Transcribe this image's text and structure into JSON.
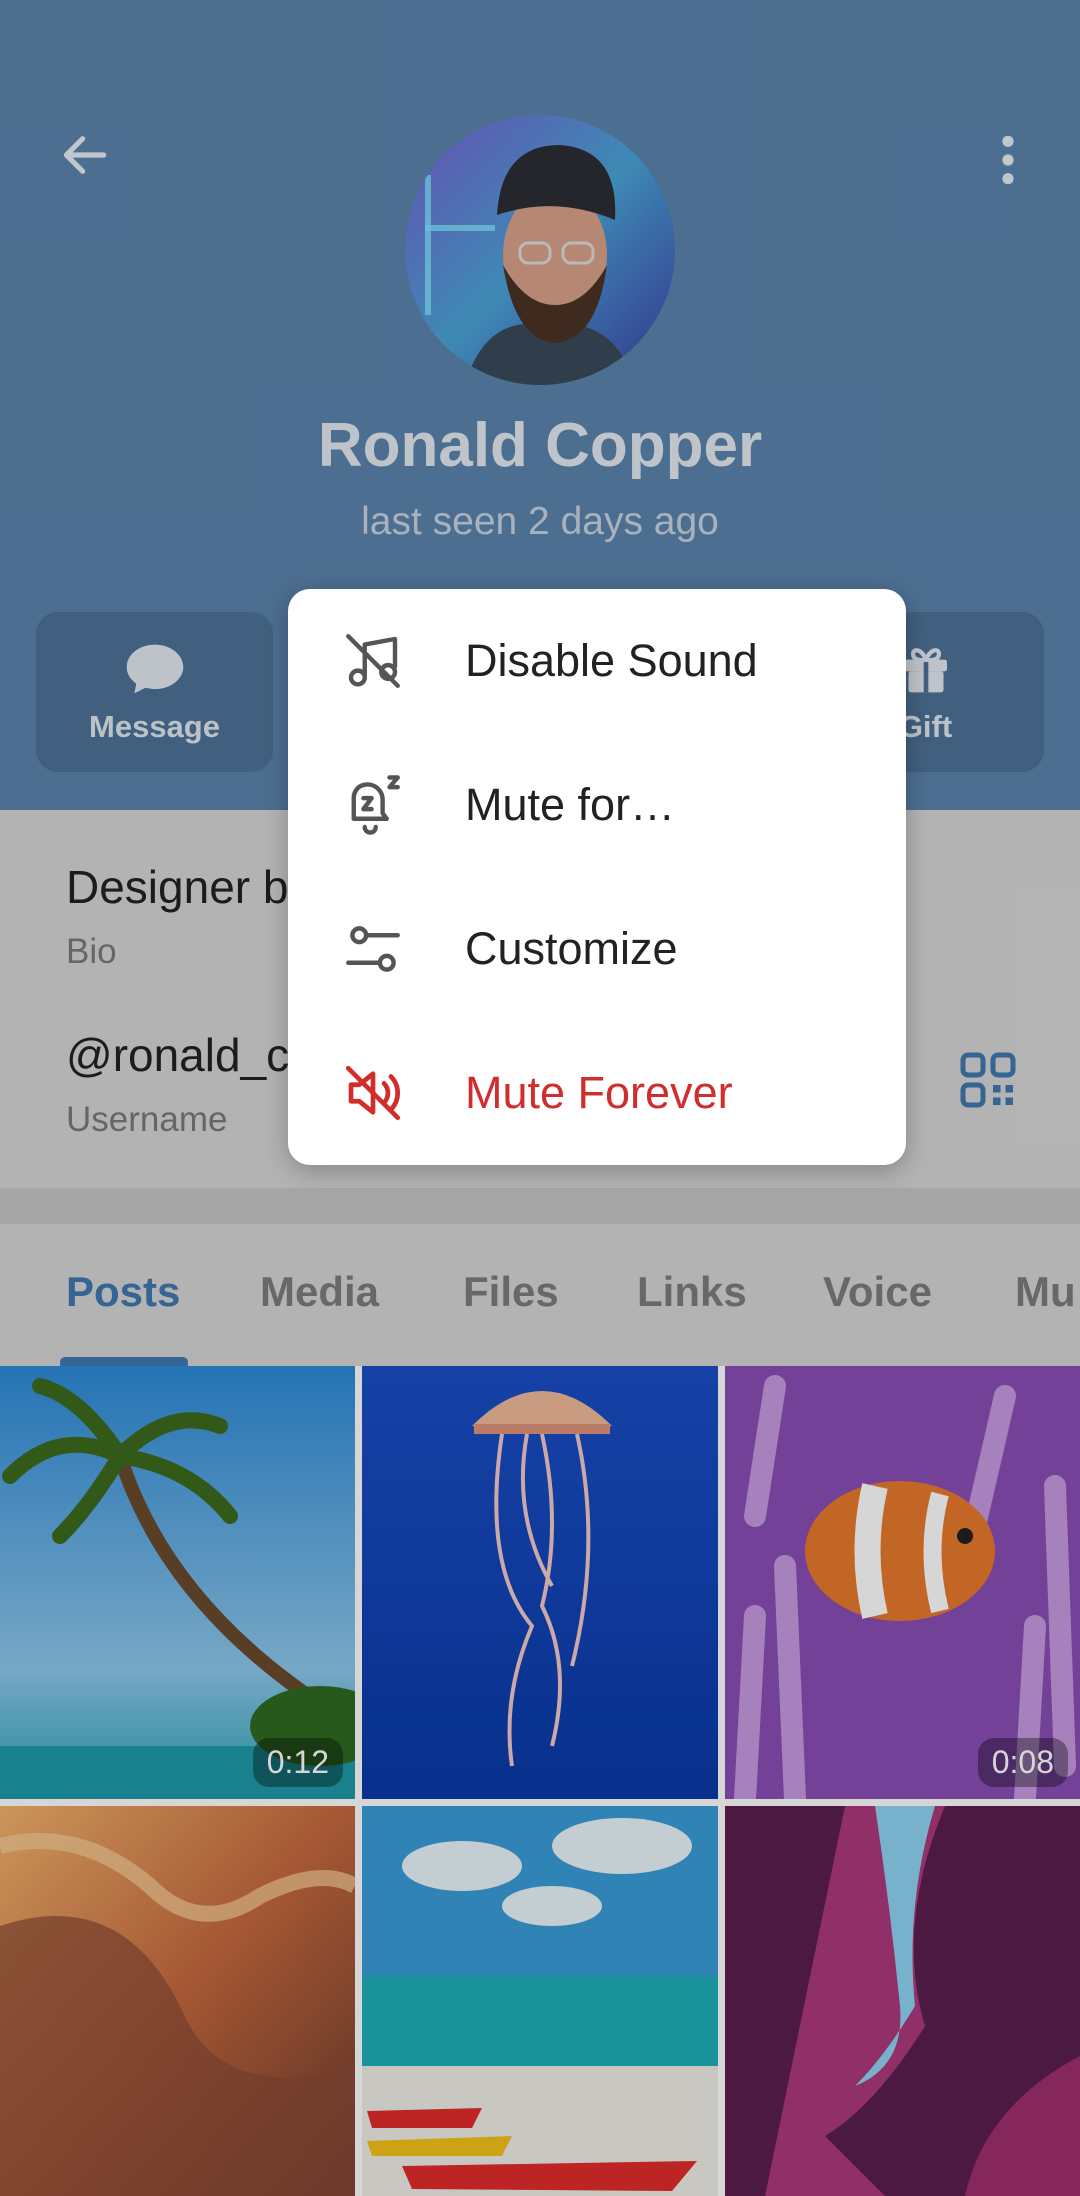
{
  "profile": {
    "name": "Ronald Copper",
    "status": "last seen 2 days ago"
  },
  "actions": {
    "message_label": "Message",
    "gift_label": "Gift"
  },
  "info": {
    "bio_value": "Designer b",
    "bio_label": "Bio",
    "username_value": "@ronald_c",
    "username_label": "Username"
  },
  "tabs": [
    {
      "label": "Posts",
      "active": true
    },
    {
      "label": "Media",
      "active": false
    },
    {
      "label": "Files",
      "active": false
    },
    {
      "label": "Links",
      "active": false
    },
    {
      "label": "Voice",
      "active": false
    },
    {
      "label": "Mu",
      "active": false
    }
  ],
  "media": [
    {
      "subject": "palm tree beach",
      "duration": "0:12"
    },
    {
      "subject": "jellyfish",
      "duration": ""
    },
    {
      "subject": "clownfish",
      "duration": "0:08"
    },
    {
      "subject": "sandstone canyon",
      "duration": ""
    },
    {
      "subject": "kayaks on beach",
      "duration": ""
    },
    {
      "subject": "purple canyon",
      "duration": ""
    }
  ],
  "menu": {
    "items": [
      {
        "label": "Disable Sound",
        "icon": "music-off-icon",
        "danger": false
      },
      {
        "label": "Mute for…",
        "icon": "bell-snooze-icon",
        "danger": false
      },
      {
        "label": "Customize",
        "icon": "sliders-icon",
        "danger": false
      },
      {
        "label": "Mute Forever",
        "icon": "volume-off-icon",
        "danger": true
      }
    ]
  },
  "colors": {
    "header_bg": "#5b84ac",
    "accent": "#3f79b0",
    "danger": "#d22d2d"
  }
}
